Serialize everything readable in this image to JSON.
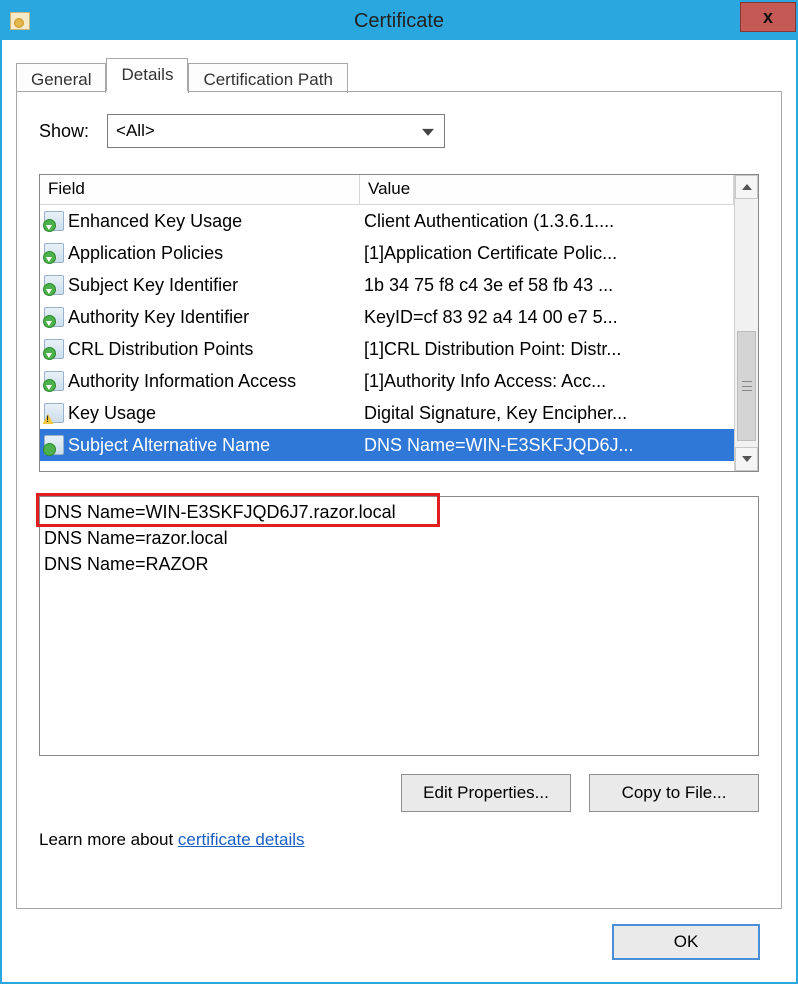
{
  "window": {
    "title": "Certificate",
    "close": "x"
  },
  "tabs": {
    "general": "General",
    "details": "Details",
    "certpath": "Certification Path"
  },
  "show": {
    "label": "Show:",
    "value": "<All>"
  },
  "list": {
    "headers": {
      "field": "Field",
      "value": "Value"
    },
    "rows": [
      {
        "icon": "cert-ext",
        "field": "Enhanced Key Usage",
        "value": "Client Authentication (1.3.6.1...."
      },
      {
        "icon": "cert-ext",
        "field": "Application Policies",
        "value": "[1]Application Certificate Polic..."
      },
      {
        "icon": "cert-ext",
        "field": "Subject Key Identifier",
        "value": "1b 34 75 f8 c4 3e ef 58 fb 43 ..."
      },
      {
        "icon": "cert-ext",
        "field": "Authority Key Identifier",
        "value": "KeyID=cf 83 92 a4 14 00 e7 5..."
      },
      {
        "icon": "cert-ext",
        "field": "CRL Distribution Points",
        "value": "[1]CRL Distribution Point: Distr..."
      },
      {
        "icon": "cert-ext",
        "field": "Authority Information Access",
        "value": "[1]Authority Info Access: Acc..."
      },
      {
        "icon": "cert-warn",
        "field": "Key Usage",
        "value": "Digital Signature, Key Encipher..."
      },
      {
        "icon": "cert-sel",
        "field": "Subject Alternative Name",
        "value": "DNS Name=WIN-E3SKFJQD6J..."
      }
    ],
    "selected_index": 7
  },
  "detail": {
    "lines": [
      "DNS Name=WIN-E3SKFJQD6J7.razor.local",
      "DNS Name=razor.local",
      "DNS Name=RAZOR"
    ]
  },
  "buttons": {
    "edit": "Edit Properties...",
    "copy": "Copy to File...",
    "ok": "OK"
  },
  "learn": {
    "prefix": "Learn more about ",
    "link": "certificate details"
  }
}
